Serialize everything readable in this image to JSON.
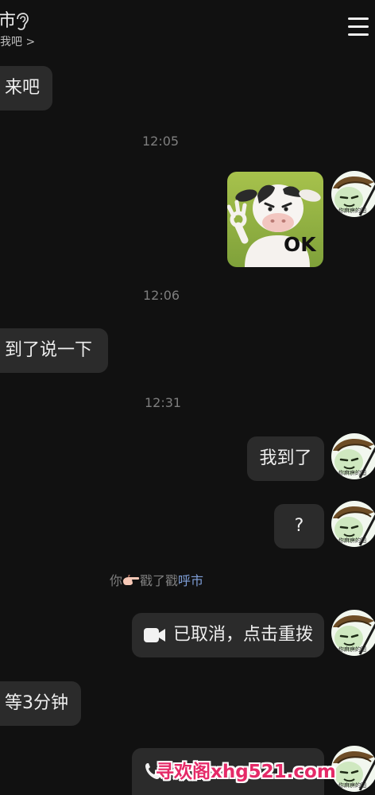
{
  "header": {
    "contact_name": "市",
    "subtitle": "我吧 >",
    "ear_icon": "ear-icon",
    "menu_icon": "menu-icon"
  },
  "messages": {
    "m1": "来吧",
    "t1": "12:05",
    "sticker_text": "OK",
    "t2": "12:06",
    "m2": "到了说一下",
    "t3": "12:31",
    "m3": "我到了",
    "m4": "?",
    "system": {
      "prefix": "你",
      "mid": "戳了戳",
      "target": "呼市"
    },
    "call": "已取消，点击重拨",
    "m5": "等3分钟"
  },
  "avatar_caption": "你麻痹的图",
  "watermark": "寻欢阁xhg521.com",
  "colors": {
    "background": "#111111",
    "bubble": "#2b2b2b",
    "timestamp": "#7e7e7e",
    "link": "#7f9fd8",
    "watermark": "#e52a68"
  }
}
